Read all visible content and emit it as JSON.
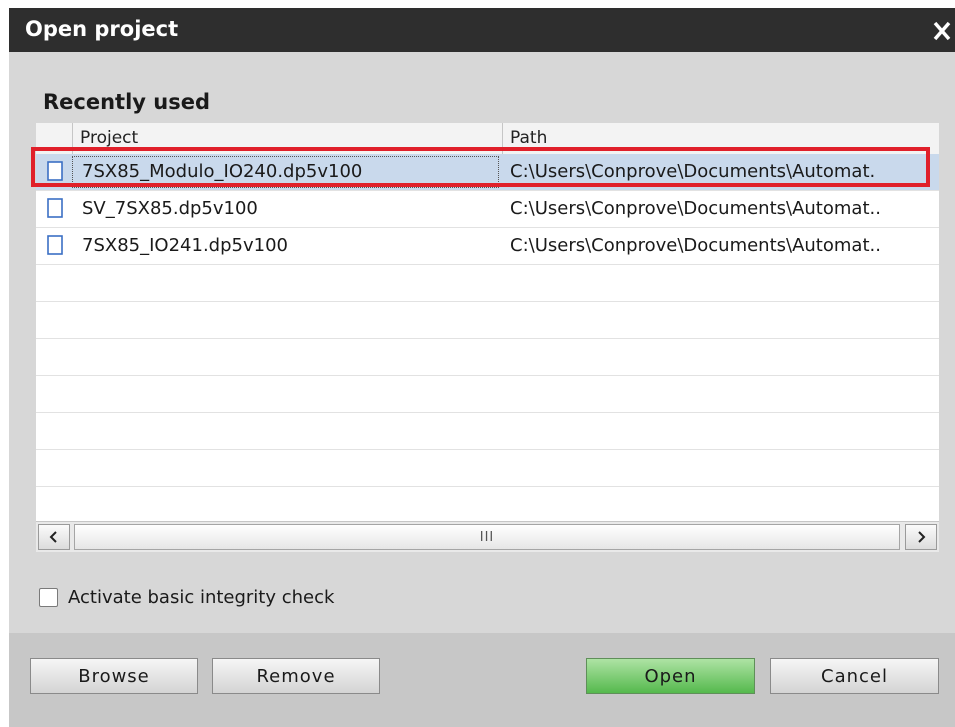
{
  "window": {
    "title": "Open project",
    "close_icon": "close-icon"
  },
  "section": {
    "heading": "Recently used"
  },
  "table": {
    "columns": [
      "Project",
      "Path"
    ],
    "rows": [
      {
        "project": "7SX85_Modulo_IO240.dp5v100",
        "path": "C:\\Users\\Conprove\\Documents\\Automat.",
        "selected": true,
        "icon": "document-icon"
      },
      {
        "project": "SV_7SX85.dp5v100",
        "path": "C:\\Users\\Conprove\\Documents\\Automat..",
        "selected": false,
        "icon": "document-icon"
      },
      {
        "project": "7SX85_IO241.dp5v100",
        "path": "C:\\Users\\Conprove\\Documents\\Automat..",
        "selected": false,
        "icon": "document-icon"
      }
    ],
    "empty_row_count": 7
  },
  "scrollbar": {
    "left_icon": "chevron-left-icon",
    "right_icon": "chevron-right-icon",
    "grip": "III"
  },
  "options": {
    "integrity_check_label": "Activate basic integrity check",
    "integrity_check_checked": false
  },
  "buttons": {
    "browse": "Browse",
    "remove": "Remove",
    "open": "Open",
    "cancel": "Cancel"
  },
  "colors": {
    "title_bar": "#2e2e2e",
    "selection": "#c9d9ec",
    "highlight": "#e0202a",
    "open_button": "#6cc463"
  }
}
